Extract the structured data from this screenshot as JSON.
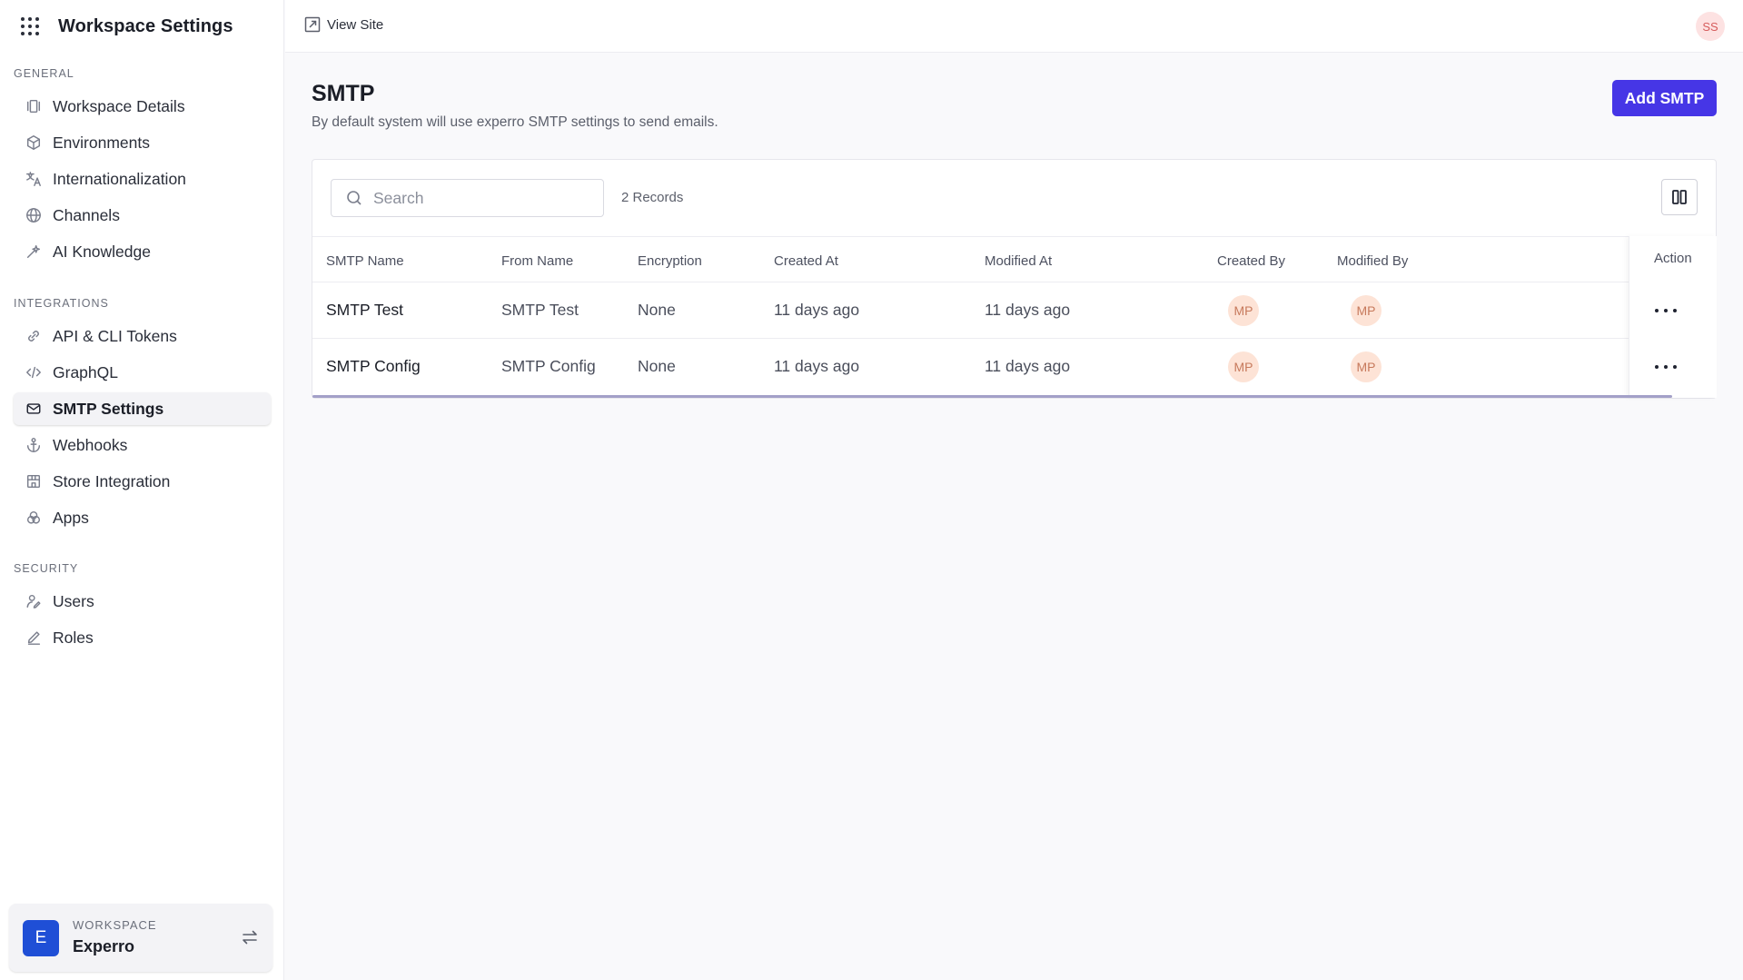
{
  "sidebar": {
    "title": "Workspace Settings",
    "grid_icon": "apps-grid-icon",
    "sections": {
      "general": "GENERAL",
      "integrations": "INTEGRATIONS",
      "security": "SECURITY"
    },
    "items": [
      {
        "label": "Workspace Details",
        "icon": "workspace-details-icon"
      },
      {
        "label": "Environments",
        "icon": "cube-icon"
      },
      {
        "label": "Internationalization",
        "icon": "translate-icon"
      },
      {
        "label": "Channels",
        "icon": "globe-icon"
      },
      {
        "label": "AI Knowledge",
        "icon": "sparkle-wand-icon"
      },
      {
        "label": "API & CLI Tokens",
        "icon": "link-icon"
      },
      {
        "label": "GraphQL",
        "icon": "code-icon"
      },
      {
        "label": "SMTP Settings",
        "icon": "mail-icon",
        "active": true
      },
      {
        "label": "Webhooks",
        "icon": "anchor-icon"
      },
      {
        "label": "Store Integration",
        "icon": "store-icon"
      },
      {
        "label": "Apps",
        "icon": "apps-circles-icon"
      },
      {
        "label": "Users",
        "icon": "users-icon"
      },
      {
        "label": "Roles",
        "icon": "pencil-icon"
      }
    ],
    "workspace": {
      "label": "WORKSPACE",
      "name": "Experro",
      "avatar_letter": "E",
      "switch_icon": "swap-arrows-icon"
    }
  },
  "topbar": {
    "view_site": "View Site",
    "user_initials": "SS"
  },
  "main": {
    "title": "SMTP",
    "subtitle": "By default system will use experro SMTP settings to send emails.",
    "add_button": "Add SMTP",
    "search_placeholder": "Search",
    "records": "2 Records",
    "columns": [
      "SMTP Name",
      "From Name",
      "Encryption",
      "Created At",
      "Modified At",
      "Created By",
      "Modified By",
      "Action"
    ],
    "rows": [
      {
        "smtp_name": "SMTP Test",
        "from_name": "SMTP Test",
        "encryption": "None",
        "created_at": "11 days ago",
        "modified_at": "11 days ago",
        "created_by": "MP",
        "modified_by": "MP"
      },
      {
        "smtp_name": "SMTP Config",
        "from_name": "SMTP Config",
        "encryption": "None",
        "created_at": "11 days ago",
        "modified_at": "11 days ago",
        "created_by": "MP",
        "modified_by": "MP"
      }
    ]
  },
  "colors": {
    "accent": "#4636e6",
    "workspace_avatar": "#1f4fd6",
    "user_avatar_bg": "#fde2e2",
    "row_avatar_bg": "#fde3d6"
  }
}
